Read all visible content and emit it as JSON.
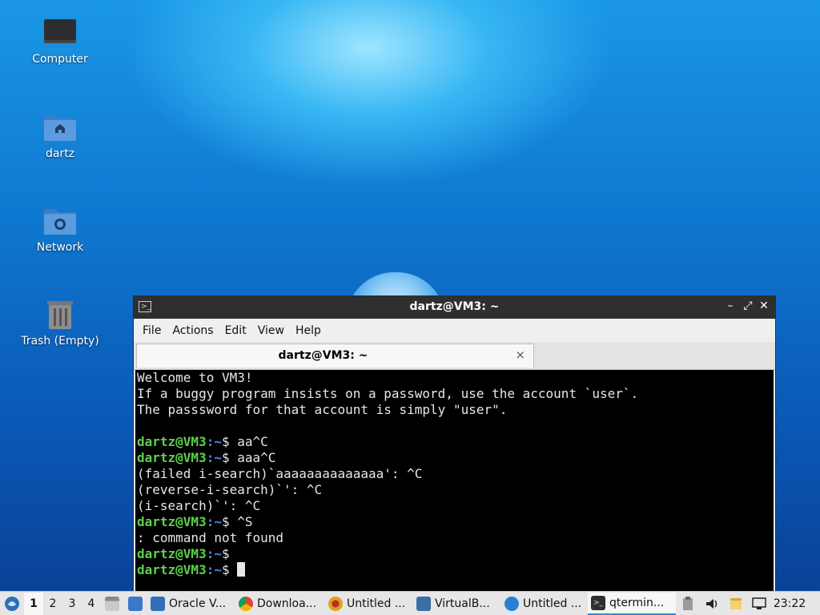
{
  "desktop": {
    "icons": [
      {
        "label": "Computer",
        "icon": "computer-icon"
      },
      {
        "label": "dartz",
        "icon": "home-folder-icon"
      },
      {
        "label": "Network",
        "icon": "network-folder-icon"
      },
      {
        "label": "Trash (Empty)",
        "icon": "trash-icon"
      }
    ]
  },
  "window": {
    "title": "dartz@VM3: ~",
    "menu": [
      "File",
      "Actions",
      "Edit",
      "View",
      "Help"
    ],
    "tab_label": "dartz@VM3: ~",
    "tab_close": "×",
    "controls": {
      "minimize": "–",
      "maximize": "⤢",
      "close": "✕"
    }
  },
  "terminal": {
    "prompt_user": "dartz@VM3",
    "prompt_sep": ":",
    "prompt_path": "~",
    "lines": [
      {
        "type": "text",
        "text": "Welcome to VM3!"
      },
      {
        "type": "text",
        "text": "If a buggy program insists on a password, use the account `user`."
      },
      {
        "type": "text",
        "text": "The passsword for that account is simply \"user\"."
      },
      {
        "type": "text",
        "text": ""
      },
      {
        "type": "prompt",
        "cmd": "$ aa^C"
      },
      {
        "type": "prompt",
        "cmd": "$ aaa^C"
      },
      {
        "type": "text",
        "text": "(failed i-search)`aaaaaaaaaaaaaa': ^C"
      },
      {
        "type": "text",
        "text": "(reverse-i-search)`': ^C"
      },
      {
        "type": "text",
        "text": "(i-search)`': ^C"
      },
      {
        "type": "prompt",
        "cmd": "$ ^S"
      },
      {
        "type": "text",
        "text": ": command not found"
      },
      {
        "type": "prompt",
        "cmd": "$"
      },
      {
        "type": "prompt",
        "cmd": "$ ",
        "cursor": true
      }
    ]
  },
  "taskbar": {
    "workspaces": [
      "1",
      "2",
      "3",
      "4"
    ],
    "active_workspace": "1",
    "tasks": [
      {
        "label": "Oracle V...",
        "icon": "virtualbox-manager-icon",
        "color": "#2f6fb5"
      },
      {
        "label": "Downloa...",
        "icon": "chrome-icon",
        "color": "#db4437"
      },
      {
        "label": "Untitled ...",
        "icon": "untitled-app-icon",
        "color": "#e0a020"
      },
      {
        "label": "VirtualB...",
        "icon": "virtualbox-icon",
        "color": "#3a6ea5"
      },
      {
        "label": "Untitled ...",
        "icon": "network-app-icon",
        "color": "#2a7fd4"
      },
      {
        "label": "qtermin...",
        "icon": "terminal-icon",
        "color": "#2f2f2f"
      }
    ],
    "clock": "23:22"
  }
}
